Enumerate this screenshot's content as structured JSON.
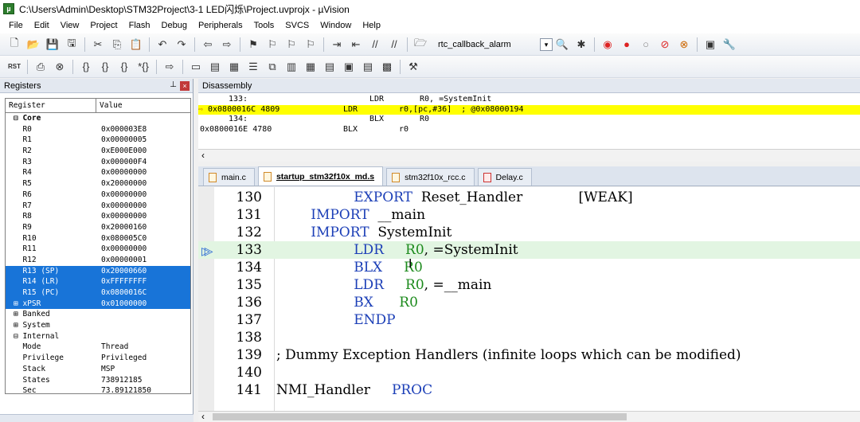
{
  "window": {
    "title": "C:\\Users\\Admin\\Desktop\\STM32Project\\3-1 LED闪烁\\Project.uvprojx - µVision"
  },
  "menu": [
    "File",
    "Edit",
    "View",
    "Project",
    "Flash",
    "Debug",
    "Peripherals",
    "Tools",
    "SVCS",
    "Window",
    "Help"
  ],
  "toolbar": {
    "target_combo": "rtc_callback_alarm"
  },
  "registers": {
    "title": "Registers",
    "col_register": "Register",
    "col_value": "Value",
    "rows": [
      {
        "name": "⊟ Core",
        "value": ""
      },
      {
        "name": "  R0",
        "value": "0x000003E8"
      },
      {
        "name": "  R1",
        "value": "0x00000005"
      },
      {
        "name": "  R2",
        "value": "0xE000E000"
      },
      {
        "name": "  R3",
        "value": "0x000000F4"
      },
      {
        "name": "  R4",
        "value": "0x00000000"
      },
      {
        "name": "  R5",
        "value": "0x20000000"
      },
      {
        "name": "  R6",
        "value": "0x00000000"
      },
      {
        "name": "  R7",
        "value": "0x00000000"
      },
      {
        "name": "  R8",
        "value": "0x00000000"
      },
      {
        "name": "  R9",
        "value": "0x20000160"
      },
      {
        "name": "  R10",
        "value": "0x080005C0"
      },
      {
        "name": "  R11",
        "value": "0x00000000"
      },
      {
        "name": "  R12",
        "value": "0x00000001"
      },
      {
        "name": "  R13 (SP)",
        "value": "0x20000660"
      },
      {
        "name": "  R14 (LR)",
        "value": "0xFFFFFFFF"
      },
      {
        "name": "  R15 (PC)",
        "value": "0x0800016C"
      },
      {
        "name": "⊞ xPSR",
        "value": "0x01000000"
      },
      {
        "name": "⊞ Banked",
        "value": ""
      },
      {
        "name": "⊞ System",
        "value": ""
      },
      {
        "name": "⊟ Internal",
        "value": ""
      },
      {
        "name": "  Mode",
        "value": "Thread"
      },
      {
        "name": "  Privilege",
        "value": "Privileged"
      },
      {
        "name": "  Stack",
        "value": "MSP"
      },
      {
        "name": "  States",
        "value": "738912185"
      },
      {
        "name": "  Sec",
        "value": "73.89121850"
      }
    ]
  },
  "disassembly": {
    "title": "Disassembly",
    "lines": [
      {
        "addr": "",
        "num": "133:",
        "mnem": "LDR",
        "ops": "R0, =SystemInit",
        "src": true
      },
      {
        "addr": "0x0800016C 4809",
        "num": "",
        "mnem": "LDR",
        "ops": "r0,[pc,#36]  ; @0x08000194",
        "current": true
      },
      {
        "addr": "",
        "num": "134:",
        "mnem": "BLX",
        "ops": "R0",
        "src": true
      },
      {
        "addr": "0x0800016E 4780",
        "num": "",
        "mnem": "BLX",
        "ops": "r0"
      }
    ]
  },
  "tabs": [
    {
      "label": "main.c",
      "type": "c"
    },
    {
      "label": "startup_stm32f10x_md.s",
      "type": "s",
      "active": true
    },
    {
      "label": "stm32f10x_rcc.c",
      "type": "c"
    },
    {
      "label": "Delay.c",
      "type": "c"
    }
  ],
  "code": [
    {
      "ln": "130",
      "parts": [
        [
          "kw",
          "                  EXPORT  "
        ],
        [
          "txt",
          "Reset_Handler             [WEAK]"
        ]
      ]
    },
    {
      "ln": "131",
      "parts": [
        [
          "kw",
          "        IMPORT  "
        ],
        [
          "txt",
          "__main"
        ]
      ]
    },
    {
      "ln": "132",
      "parts": [
        [
          "kw",
          "        IMPORT  "
        ],
        [
          "txt",
          "SystemInit"
        ]
      ]
    },
    {
      "ln": "133",
      "parts": [
        [
          "kw",
          "                  LDR     "
        ],
        [
          "reg",
          "R0"
        ],
        [
          "txt",
          ", =SystemInit"
        ]
      ],
      "current": true
    },
    {
      "ln": "134",
      "parts": [
        [
          "kw",
          "                  BLX     "
        ],
        [
          "reg",
          "R0"
        ]
      ]
    },
    {
      "ln": "135",
      "parts": [
        [
          "kw",
          "                  LDR     "
        ],
        [
          "reg",
          "R0"
        ],
        [
          "txt",
          ", =__main"
        ]
      ]
    },
    {
      "ln": "136",
      "parts": [
        [
          "kw",
          "                  BX      "
        ],
        [
          "reg",
          "R0"
        ]
      ]
    },
    {
      "ln": "137",
      "parts": [
        [
          "kw",
          "                  ENDP"
        ]
      ]
    },
    {
      "ln": "138",
      "parts": []
    },
    {
      "ln": "139",
      "parts": [
        [
          "cmt",
          "; Dummy Exception Handlers (infinite loops which can be modified)"
        ]
      ]
    },
    {
      "ln": "140",
      "parts": []
    },
    {
      "ln": "141",
      "parts": [
        [
          "txt",
          "NMI_Handler     "
        ],
        [
          "kw",
          "PROC"
        ]
      ]
    }
  ]
}
